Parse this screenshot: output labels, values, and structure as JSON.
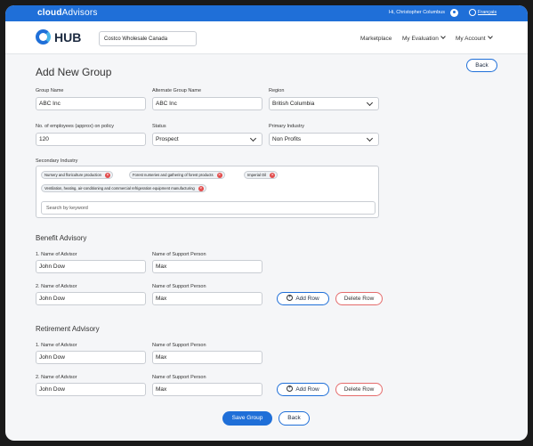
{
  "topbar": {
    "brand_a": "cloud",
    "brand_b": "Advisors",
    "greeting": "Hi, Christopher Columbus",
    "language": "Français"
  },
  "header": {
    "logo_text": "HUB",
    "company": "Costco Wholesale Canada",
    "nav": [
      "Marketplace",
      "My Evaluation",
      "My Account"
    ]
  },
  "page": {
    "title": "Add New Group",
    "back_label": "Back"
  },
  "form": {
    "group_name": {
      "label": "Group Name",
      "value": "ABC Inc"
    },
    "alt_group_name": {
      "label": "Alternate Group Name",
      "value": "ABC Inc"
    },
    "region": {
      "label": "Region",
      "value": "British Columbia"
    },
    "employees": {
      "label": "No. of employees (approx) on policy",
      "value": "120"
    },
    "status": {
      "label": "Status",
      "value": "Prospect"
    },
    "primary_industry": {
      "label": "Primary Industry",
      "value": "Non Profits"
    },
    "secondary_industry": {
      "label": "Secondary Industry",
      "chips": [
        "Nursery and floriculture production",
        "Forest nurseries and gathering of forest products",
        "Imperial Oil",
        "Ventilation, heating, air-conditioning and commercial refrigeration equipment manufacturing"
      ],
      "search_placeholder": "Search by keyword"
    }
  },
  "benefit": {
    "title": "Benefit Advisory",
    "rows": [
      {
        "advisor_label": "1. Name of Advisor",
        "advisor": "John Dow",
        "support_label": "Name of Support Person",
        "support": "Max"
      },
      {
        "advisor_label": "2. Name of Advisor",
        "advisor": "John Dow",
        "support_label": "Name of Support Person",
        "support": "Max"
      }
    ],
    "add_row": "Add Row",
    "delete_row": "Delete Row"
  },
  "retirement": {
    "title": "Retirement Advisory",
    "rows": [
      {
        "advisor_label": "1. Name of Advisor",
        "advisor": "John Dow",
        "support_label": "Name of Support Person",
        "support": "Max"
      },
      {
        "advisor_label": "2. Name of Advisor",
        "advisor": "John Dow",
        "support_label": "Name of Support Person",
        "support": "Max"
      }
    ],
    "add_row": "Add Row",
    "delete_row": "Delete Row"
  },
  "footer": {
    "save_label": "Save Group",
    "back_label": "Back"
  },
  "colors": {
    "brand_blue": "#1f6fd8",
    "danger": "#e24b4b"
  }
}
